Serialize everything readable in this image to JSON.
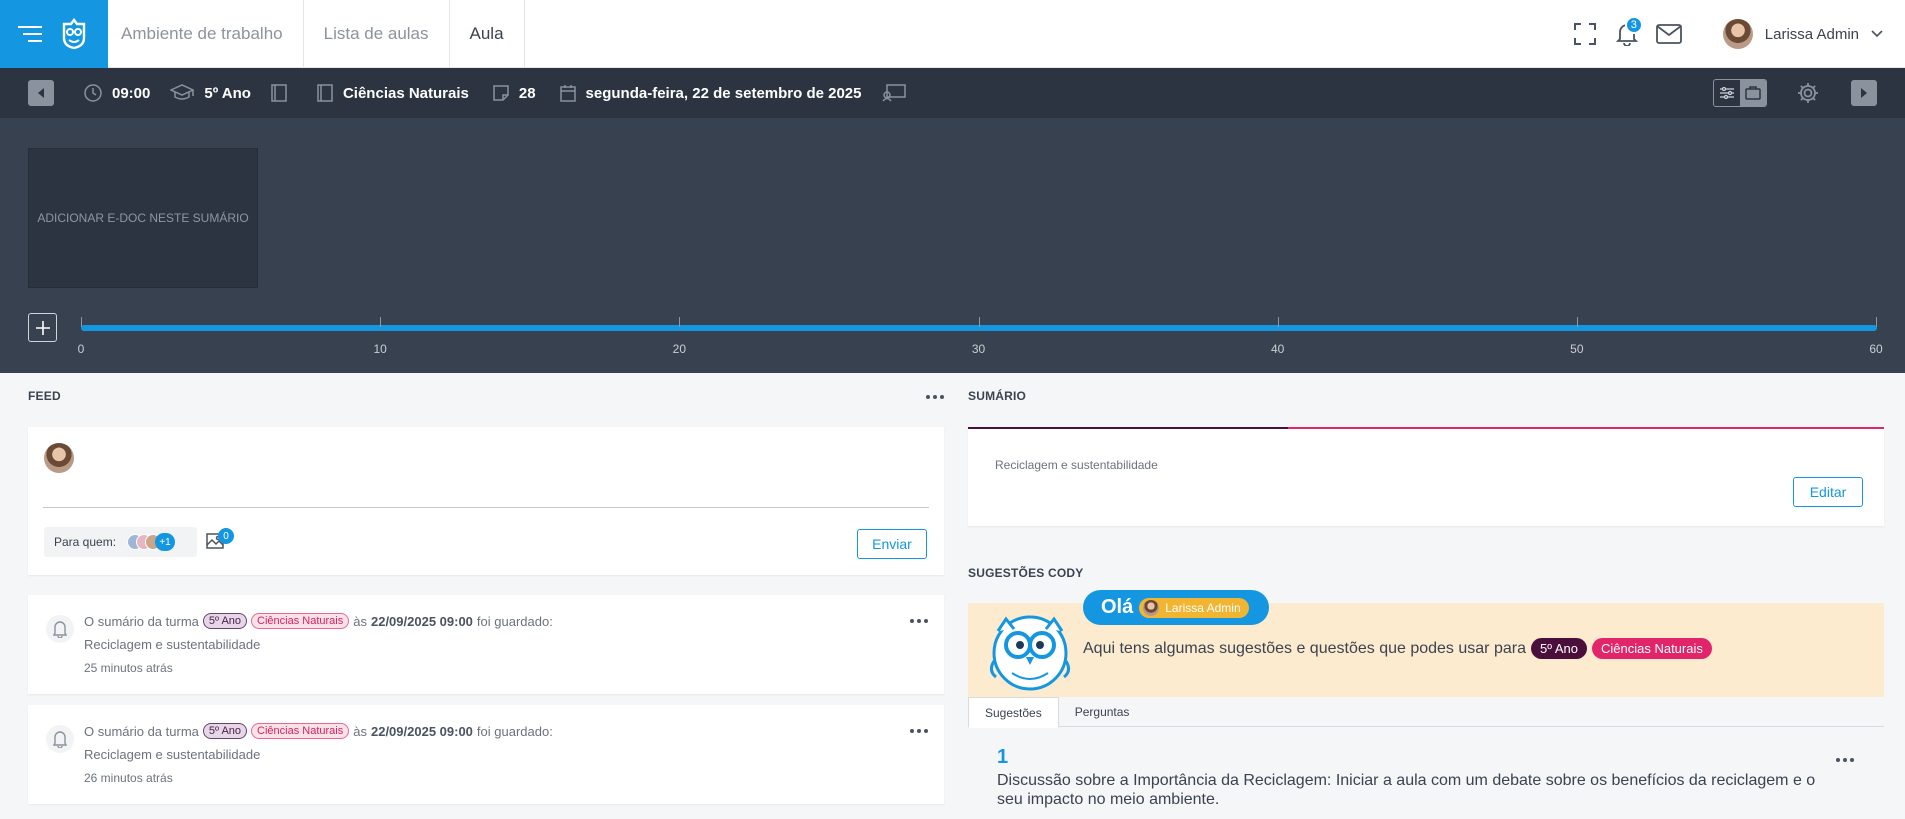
{
  "nav": {
    "tabs": [
      "Ambiente de trabalho",
      "Lista de aulas",
      "Aula"
    ],
    "notifications_count": "3",
    "user_name": "Larissa Admin"
  },
  "toolbar": {
    "time": "09:00",
    "class": "5º Ano",
    "subject": "Ciências Naturais",
    "number": "28",
    "date": "segunda-feira, 22 de setembro de 2025"
  },
  "timeline": {
    "edoc_label": "ADICIONAR E-DOC NESTE SUMÁRIO",
    "ticks": [
      "0",
      "10",
      "20",
      "30",
      "40",
      "50",
      "60"
    ]
  },
  "feed": {
    "title": "FEED",
    "para_quem": "Para quem:",
    "recipients_extra": "+1",
    "attachments_count": "0",
    "send_label": "Enviar",
    "posts": [
      {
        "prefix": "O sumário da turma",
        "class_tag": "5º Ano",
        "subject_tag": "Ciências Naturais",
        "at": "às",
        "datetime": "22/09/2025 09:00",
        "suffix": "foi guardado:",
        "content": "Reciclagem e sustentabilidade",
        "time_ago": "25 minutos atrás"
      },
      {
        "prefix": "O sumário da turma",
        "class_tag": "5º Ano",
        "subject_tag": "Ciências Naturais",
        "at": "às",
        "datetime": "22/09/2025 09:00",
        "suffix": "foi guardado:",
        "content": "Reciclagem e sustentabilidade",
        "time_ago": "26 minutos atrás"
      }
    ]
  },
  "sumario": {
    "title": "SUMÁRIO",
    "text": "Reciclagem e sustentabilidade",
    "edit_label": "Editar"
  },
  "cody": {
    "title": "SUGESTÕES CODY",
    "greeting": "Olá",
    "user_name": "Larissa Admin",
    "intro": "Aqui tens algumas sugestões e questões que podes usar para",
    "class_tag": "5º Ano",
    "subject_tag": "Ciências Naturais",
    "tabs": [
      "Sugestões",
      "Perguntas"
    ],
    "suggestions": [
      {
        "number": "1",
        "text": "Discussão sobre a Importância da Reciclagem: Iniciar a aula com um debate sobre os benefícios da reciclagem e o seu impacto no meio ambiente."
      }
    ]
  },
  "colors": {
    "primary": "#1497e0",
    "toolbar_bg": "#2c3441",
    "stage_bg": "#38414f",
    "class_tag": "#4a0f3a",
    "subject_tag": "#e2246a",
    "cody_bg": "#fdebd0"
  },
  "icons": [
    "menu-icon",
    "cody-logo-icon",
    "fullscreen-icon",
    "bell-icon",
    "mail-icon",
    "chevron-down-icon",
    "clock-icon",
    "graduation-cap-icon",
    "book-icon",
    "notebook-icon",
    "note-icon",
    "calendar-icon",
    "presentation-icon",
    "filter-icon",
    "briefcase-icon",
    "gear-icon",
    "plus-icon",
    "image-icon",
    "more-icon",
    "owl-icon"
  ]
}
